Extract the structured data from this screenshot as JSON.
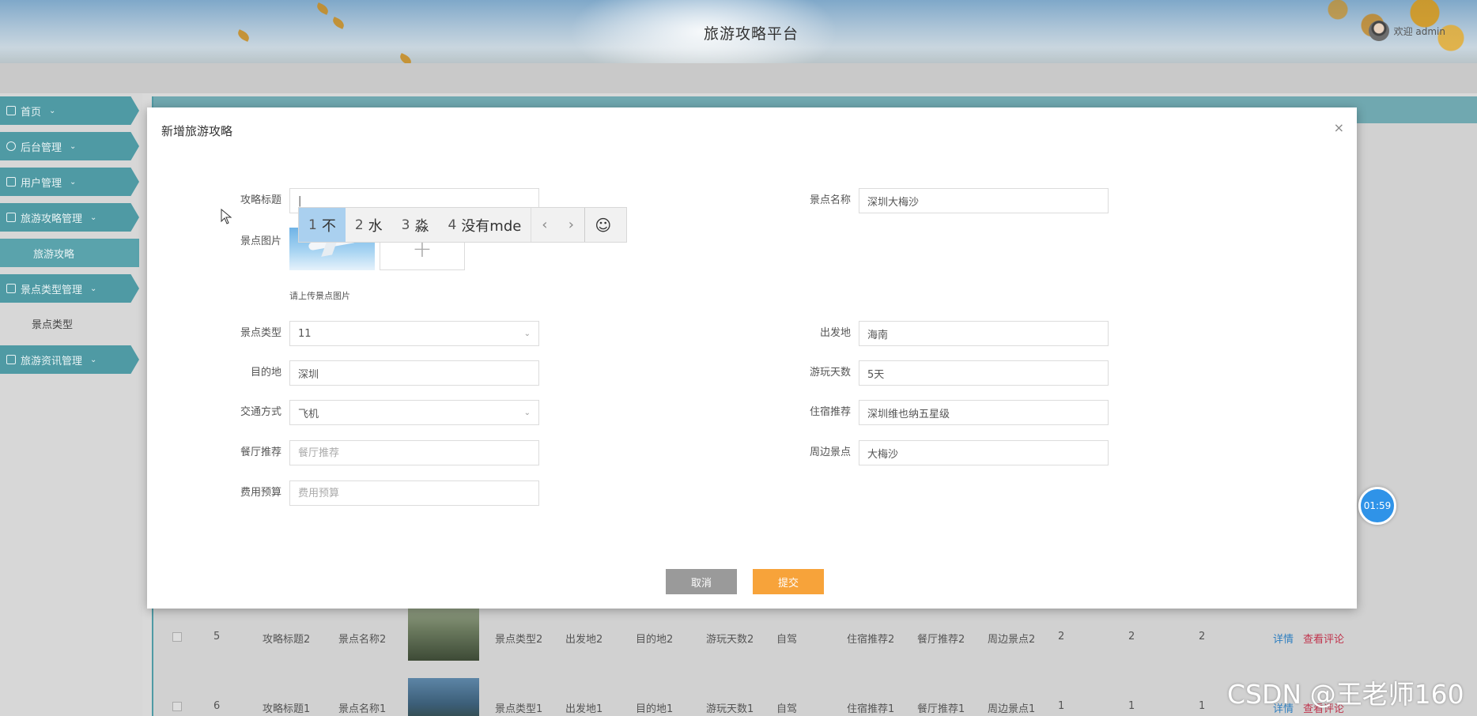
{
  "header": {
    "title": "旅游攻略平台",
    "user_text": "欢迎 admin"
  },
  "sidebar": {
    "items": [
      {
        "label": "首页",
        "icon": "home-icon"
      },
      {
        "label": "后台管理",
        "icon": "admin-icon"
      },
      {
        "label": "用户管理",
        "icon": "user-icon"
      },
      {
        "label": "旅游攻略管理",
        "icon": "guide-icon"
      },
      {
        "label": "景点类型管理",
        "icon": "type-icon"
      },
      {
        "label": "旅游资讯管理",
        "icon": "news-icon"
      }
    ],
    "subitems": {
      "guide": "旅游攻略",
      "type": "景点类型"
    },
    "chevron": "⌄"
  },
  "modal": {
    "title": "新增旅游攻略",
    "close": "×",
    "fields": {
      "title": {
        "label": "攻略标题",
        "value": "|"
      },
      "scenic_name": {
        "label": "景点名称",
        "value": "深圳大梅沙"
      },
      "image": {
        "label": "景点图片",
        "hint": "请上传景点图片",
        "add": "+"
      },
      "scenic_type": {
        "label": "景点类型",
        "value": "11"
      },
      "departure": {
        "label": "出发地",
        "value": "海南"
      },
      "destination": {
        "label": "目的地",
        "value": "深圳"
      },
      "days": {
        "label": "游玩天数",
        "value": "5天"
      },
      "transport": {
        "label": "交通方式",
        "value": "飞机"
      },
      "hotel": {
        "label": "住宿推荐",
        "value": "深圳维也纳五星级"
      },
      "restaurant": {
        "label": "餐厅推荐",
        "placeholder": "餐厅推荐"
      },
      "nearby": {
        "label": "周边景点",
        "value": "大梅沙"
      },
      "budget": {
        "label": "费用预算",
        "placeholder": "费用预算"
      }
    },
    "buttons": {
      "cancel": "取消",
      "submit": "提交"
    }
  },
  "ime": {
    "candidates": [
      {
        "n": "1",
        "text": "不"
      },
      {
        "n": "2",
        "text": "水"
      },
      {
        "n": "3",
        "text": "淼"
      },
      {
        "n": "4",
        "text": "没有mde"
      }
    ],
    "prev": "‹",
    "next": "›",
    "emoji": "☺"
  },
  "table_rows": [
    {
      "no": "5",
      "title": "攻略标题2",
      "name": "景点名称2",
      "type": "景点类型2",
      "from": "出发地2",
      "to": "目的地2",
      "days": "游玩天数2",
      "transport": "自驾",
      "hotel": "住宿推荐2",
      "restaurant": "餐厅推荐2",
      "nearby": "周边景点2",
      "c1": "2",
      "c2": "2",
      "c3": "2",
      "detail": "详情",
      "comments": "查看评论"
    },
    {
      "no": "6",
      "title": "攻略标题1",
      "name": "景点名称1",
      "type": "景点类型1",
      "from": "出发地1",
      "to": "目的地1",
      "days": "游玩天数1",
      "transport": "自驾",
      "hotel": "住宿推荐1",
      "restaurant": "餐厅推荐1",
      "nearby": "周边景点1",
      "c1": "1",
      "c2": "1",
      "c3": "1",
      "detail": "详情",
      "comments": "查看评论"
    }
  ],
  "timer": "01:59",
  "watermark": "CSDN @王老师160"
}
